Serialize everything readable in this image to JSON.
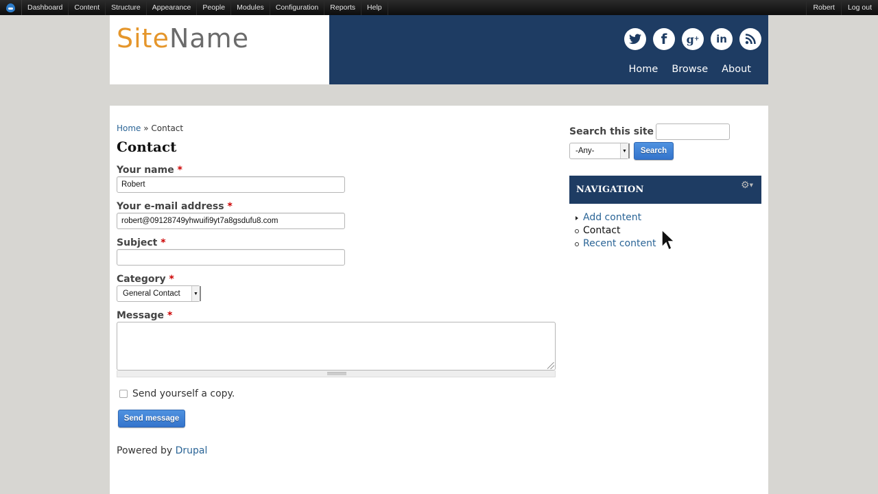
{
  "toolbar": {
    "items": [
      "Dashboard",
      "Content",
      "Structure",
      "Appearance",
      "People",
      "Modules",
      "Configuration",
      "Reports",
      "Help"
    ],
    "user": "Robert",
    "logout": "Log out"
  },
  "header": {
    "site_name_part1": "Site",
    "site_name_part2": "Name",
    "social_icons": [
      "twitter-icon",
      "facebook-icon",
      "google-plus-icon",
      "linkedin-icon",
      "rss-icon"
    ],
    "social_glyphs": [
      "🐦",
      "f",
      "g⁺",
      "in",
      "◔"
    ],
    "nav": [
      "Home",
      "Browse",
      "About"
    ]
  },
  "breadcrumb": {
    "home": "Home",
    "separator": " » ",
    "current": "Contact"
  },
  "page_title": "Contact",
  "form": {
    "name": {
      "label": "Your name",
      "required": "*",
      "value": "Robert"
    },
    "email": {
      "label": "Your e-mail address",
      "required": "*",
      "value": "robert@09128749yhwuifi9yt7a8gsdufu8.com"
    },
    "subject": {
      "label": "Subject",
      "required": "*",
      "value": ""
    },
    "category": {
      "label": "Category",
      "required": "*",
      "selected": "General Contact"
    },
    "message": {
      "label": "Message",
      "required": "*",
      "value": ""
    },
    "copy": {
      "label": "Send yourself a copy.",
      "checked": false
    },
    "submit": "Send message"
  },
  "footer": {
    "powered_prefix": "Powered by ",
    "powered_link": "Drupal"
  },
  "sidebar": {
    "search": {
      "label": "Search this site",
      "value": "",
      "type_selected": "-Any-",
      "button": "Search"
    },
    "navigation": {
      "title": "NAVIGATION",
      "items": [
        {
          "label": "Add content",
          "link": true,
          "collapsed": true
        },
        {
          "label": "Contact",
          "link": false
        },
        {
          "label": "Recent content",
          "link": true
        }
      ]
    }
  },
  "colors": {
    "header_blue": "#1e3c63",
    "site_orange": "#e5962b",
    "link_blue": "#2a6496",
    "button_blue": "#3f82d6",
    "required_red": "#cc0000",
    "page_bg": "#d7d6d2"
  }
}
